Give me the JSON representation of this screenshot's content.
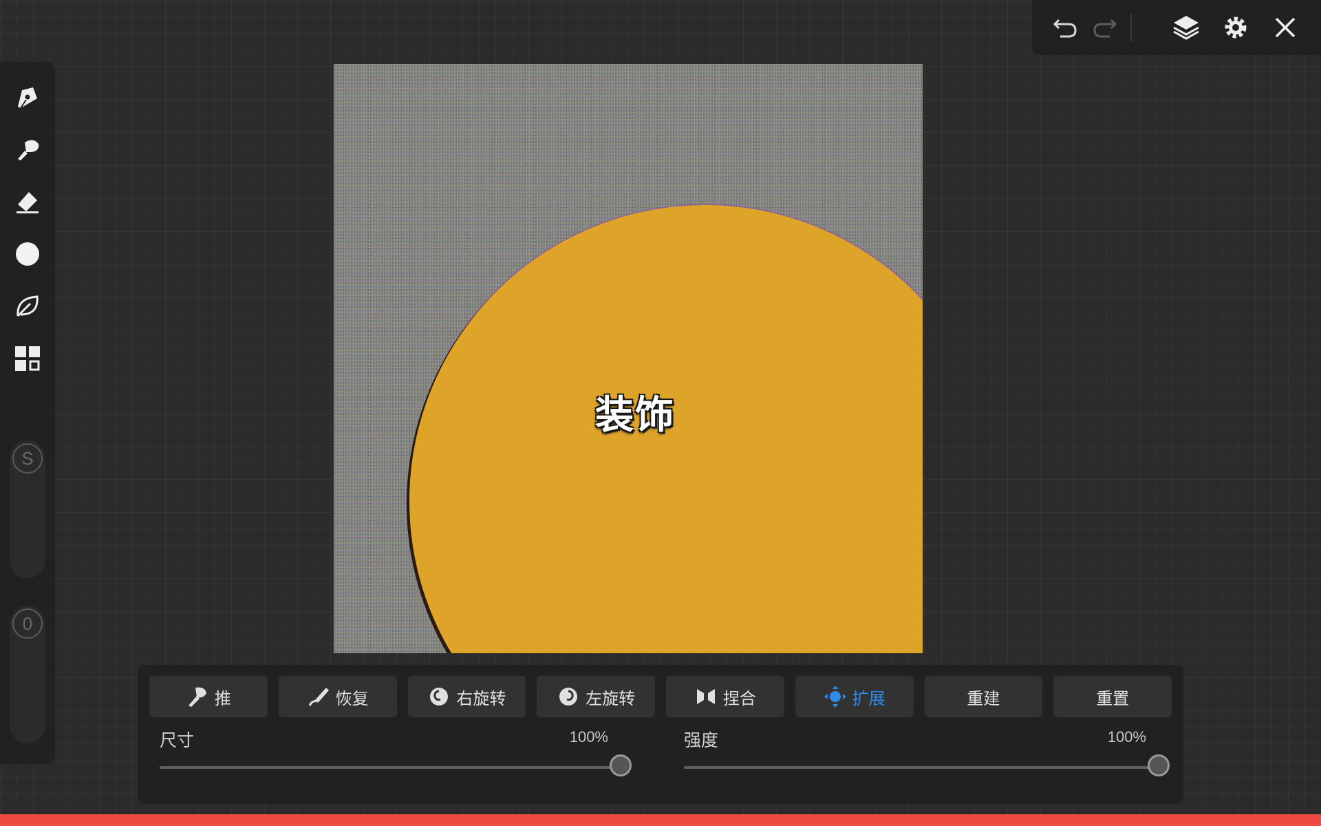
{
  "sidebar": {
    "tools": [
      {
        "name": "pen-tool",
        "icon": "pen-nib-icon"
      },
      {
        "name": "smudge-tool",
        "icon": "smudge-brush-icon"
      },
      {
        "name": "eraser-tool",
        "icon": "eraser-icon"
      },
      {
        "name": "color-picker",
        "icon": "color-circle-icon",
        "color": "#f2f2f2"
      },
      {
        "name": "liquify-tool",
        "icon": "leaf-icon"
      },
      {
        "name": "gallery",
        "icon": "grid-icon"
      }
    ],
    "size_slider": {
      "label": "S"
    },
    "opacity_slider": {
      "label": "0"
    }
  },
  "topbar": {
    "buttons": [
      "undo-icon",
      "redo-icon",
      "layers-icon",
      "gear-icon",
      "close-icon"
    ]
  },
  "canvas": {
    "title": "装饰",
    "circle_color": "#dea42a"
  },
  "liquify_panel": {
    "modes": [
      {
        "label": "推",
        "icon": "push-icon"
      },
      {
        "label": "恢复",
        "icon": "restore-icon"
      },
      {
        "label": "右旋转",
        "icon": "twirl-right-icon"
      },
      {
        "label": "左旋转",
        "icon": "twirl-left-icon"
      },
      {
        "label": "捏合",
        "icon": "pinch-icon"
      },
      {
        "label": "扩展",
        "icon": "expand-icon",
        "active": true
      },
      {
        "label": "重建"
      },
      {
        "label": "重置"
      }
    ],
    "size": {
      "label": "尺寸",
      "value_text": "100%",
      "value": 1.0
    },
    "strength": {
      "label": "强度",
      "value_text": "100%",
      "value": 1.0
    },
    "active_color": "#2e8be8"
  },
  "status_color": "#ef4a3f"
}
